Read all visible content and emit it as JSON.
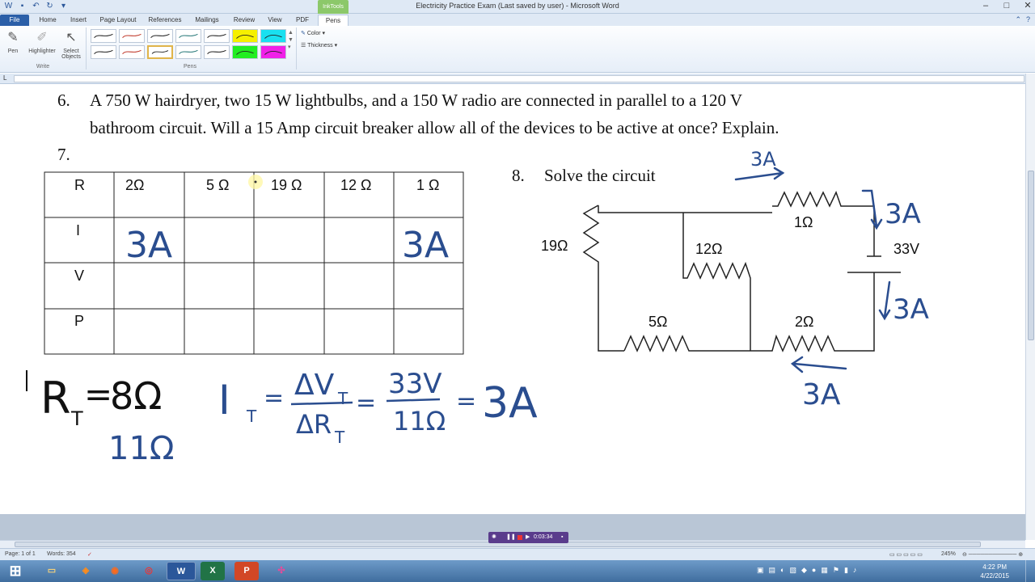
{
  "window": {
    "title": "Electricity Practice Exam (Last saved by user) - Microsoft Word",
    "context_tab": "InkTools",
    "minimize": "–",
    "maximize": "□",
    "close": "✕"
  },
  "tabs": [
    {
      "label": "File"
    },
    {
      "label": "Home"
    },
    {
      "label": "Insert"
    },
    {
      "label": "Page Layout"
    },
    {
      "label": "References"
    },
    {
      "label": "Mailings"
    },
    {
      "label": "Review"
    },
    {
      "label": "View"
    },
    {
      "label": "PDF"
    },
    {
      "label": "Pens"
    }
  ],
  "ribbon": {
    "pen_label": "Pen",
    "highlighter_label": "Highlighter",
    "select_objects_line1": "Select",
    "select_objects_line2": "Objects",
    "write_group": "Write",
    "pens_group": "Pens",
    "color_label": "Color",
    "thickness_label": "Thickness",
    "colors": {
      "pen_black": "#222222",
      "pen_red": "#c0392b",
      "pen_teal": "#2a7a7a",
      "highlight_yellow": "#f6f000",
      "highlight_cyan": "#19e0f0",
      "highlight_green": "#22ee22",
      "highlight_magenta": "#f020e8"
    }
  },
  "document": {
    "q6_number": "6.",
    "q6_line1": "A 750 W hairdryer, two 15 W lightbulbs, and a 150 W radio are connected in parallel to a 120 V",
    "q6_line2": "bathroom circuit. Will a 15 Amp circuit breaker allow all of the devices to be active at once? Explain.",
    "q7_number": "7.",
    "q8_number": "8.",
    "q8_text": "Solve the circuit",
    "table": {
      "row_headers": [
        "R",
        "I",
        "V",
        "P"
      ],
      "resistances": [
        "2Ω",
        "5 Ω",
        "19 Ω",
        "12 Ω",
        "1 Ω"
      ],
      "current_ink": [
        "3A",
        "3A"
      ]
    },
    "circuit": {
      "r1": "1Ω",
      "r19": "19Ω",
      "r12": "12Ω",
      "r5": "5Ω",
      "r2": "2Ω",
      "battery": "33V"
    },
    "ink": {
      "ink_color": "#2a4d8f",
      "top_current": "3A",
      "right_current_top": "3A",
      "right_current_bottom": "3A",
      "bottom_current": "3A",
      "rt_symbol": "R",
      "rt_sub": "T",
      "rt_equals": "=",
      "rt_scribble": "8Ω",
      "rt_value": "11Ω",
      "it_symbol": "I",
      "it_sub": "T",
      "eq1": "=",
      "dv": "ΔV",
      "dv_sub": "T",
      "dr": "ΔR",
      "dr_sub": "T",
      "eq2": "=",
      "num": "33V",
      "den": "11Ω",
      "eq3": "=",
      "result": "3A"
    }
  },
  "recorder": {
    "time": "0:03:34"
  },
  "status": {
    "page": "Page: 1 of 1",
    "words": "Words: 354",
    "zoom": "245%"
  },
  "taskbar": {
    "clock_time": "4:22 PM",
    "clock_date": "4/22/2015",
    "apps": [
      "explorer",
      "firefox",
      "chrome",
      "word",
      "excel",
      "powerpoint",
      "slack"
    ]
  }
}
